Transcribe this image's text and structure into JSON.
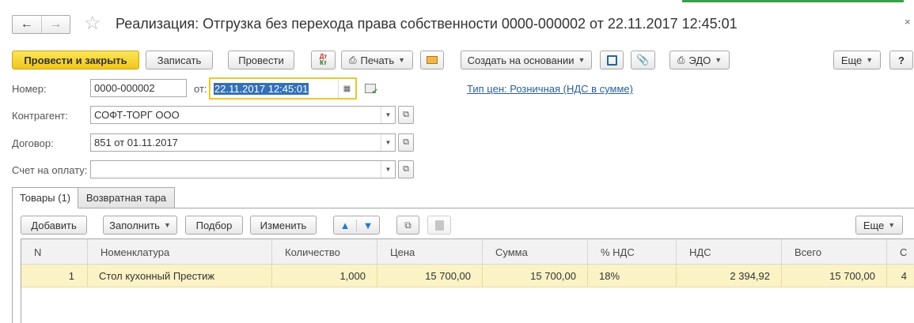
{
  "header": {
    "back_icon": "arrow-left-icon",
    "forward_icon": "arrow-right-icon",
    "favorite_icon": "star-icon",
    "title": "Реализация: Отгрузка без перехода права собственности 0000-000002 от 22.11.2017 12:45:01",
    "close_icon": "close-icon"
  },
  "toolbar": {
    "post_close": "Провести и закрыть",
    "save": "Записать",
    "post": "Провести",
    "dtkt_top": "Дт",
    "dtkt_bottom": "Кт",
    "print": "Печать",
    "create_based": "Создать на основании",
    "edo": "ЭДО",
    "more": "Еще",
    "help": "?"
  },
  "form": {
    "number_label": "Номер:",
    "number_value": "0000-000002",
    "date_label": "от:",
    "date_value": "22.11.2017 12:45:01",
    "price_type_link": "Тип цен: Розничная (НДС в сумме)",
    "counterparty_label": "Контрагент:",
    "counterparty_value": "СОФТ-ТОРГ ООО",
    "contract_label": "Договор:",
    "contract_value": "851 от 01.11.2017",
    "invoice_label": "Счет на оплату:",
    "invoice_value": ""
  },
  "tabs": [
    {
      "label": "Товары (1)",
      "active": true
    },
    {
      "label": "Возвратная тара",
      "active": false
    }
  ],
  "table_toolbar": {
    "add": "Добавить",
    "fill": "Заполнить",
    "select": "Подбор",
    "change": "Изменить",
    "more": "Еще"
  },
  "table": {
    "columns": [
      "N",
      "Номенклатура",
      "Количество",
      "Цена",
      "Сумма",
      "% НДС",
      "НДС",
      "Всего",
      "С"
    ],
    "rows": [
      [
        "1",
        "Стол кухонный Престиж",
        "1,000",
        "15 700,00",
        "15 700,00",
        "18%",
        "2 394,92",
        "15 700,00",
        "4"
      ]
    ]
  },
  "colors": {
    "primary_button": "#f2c51c",
    "selected_row": "#fbf2c5",
    "link": "#2a5e9a",
    "date_focus_border": "#f0c62a",
    "selection": "#3370b7"
  }
}
